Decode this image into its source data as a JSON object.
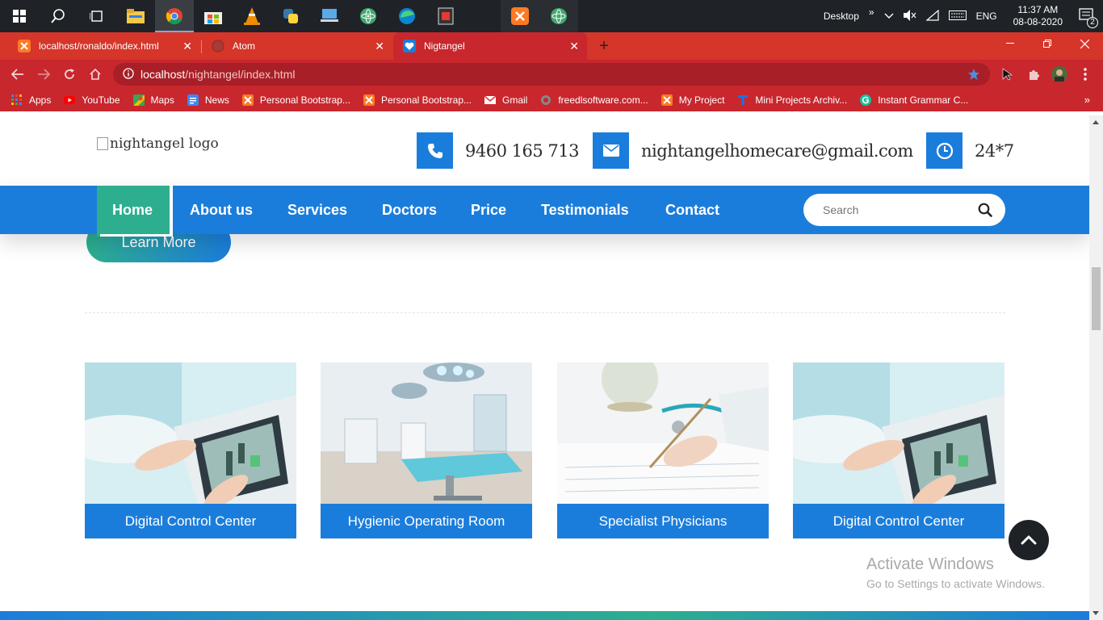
{
  "taskbar": {
    "desktop_label": "Desktop",
    "language": "ENG",
    "time": "11:37 AM",
    "date": "08-08-2020",
    "notification_count": "2"
  },
  "browser": {
    "tabs": [
      {
        "title": "localhost/ronaldo/index.html",
        "active": false
      },
      {
        "title": "Atom",
        "active": false
      },
      {
        "title": "Nigtangel",
        "active": true
      }
    ],
    "url_host": "localhost",
    "url_path": "/nightangel/index.html",
    "bookmarks": [
      {
        "label": "Apps",
        "color": "#4285f4"
      },
      {
        "label": "YouTube",
        "color": "#ff0000"
      },
      {
        "label": "Maps",
        "color": "#34a853"
      },
      {
        "label": "News",
        "color": "#4285f4"
      },
      {
        "label": "Personal Bootstrap...",
        "color": "#fb7a24"
      },
      {
        "label": "Personal Bootstrap...",
        "color": "#fb7a24"
      },
      {
        "label": "Gmail",
        "color": "#ffffff"
      },
      {
        "label": "freedlsoftware.com...",
        "color": "#888888"
      },
      {
        "label": "My Project",
        "color": "#fb7a24"
      },
      {
        "label": "Mini Projects Archiv...",
        "color": "#1a73e8"
      },
      {
        "label": "Instant Grammar C...",
        "color": "#15c39a"
      }
    ]
  },
  "site": {
    "logo_alt": "nightangel logo",
    "phone": "9460 165 713",
    "email": "nightangelhomecare@gmail.com",
    "hours": "24*7",
    "nav": [
      "Home",
      "About us",
      "Services",
      "Doctors",
      "Price",
      "Testimonials",
      "Contact"
    ],
    "search_placeholder": "Search",
    "learn_more": "Learn More",
    "cards": [
      {
        "caption": "Digital Control Center"
      },
      {
        "caption": "Hygienic Operating Room"
      },
      {
        "caption": "Specialist Physicians"
      },
      {
        "caption": "Digital Control Center"
      }
    ],
    "watermark_title": "Activate Windows",
    "watermark_sub": "Go to Settings to activate Windows."
  },
  "colors": {
    "primary": "#1b7ddb",
    "accent": "#2dae8f",
    "browser_red": "#c8272e"
  }
}
